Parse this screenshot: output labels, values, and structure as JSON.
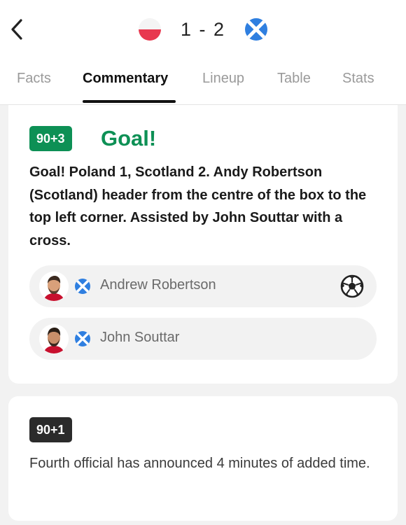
{
  "header": {
    "home_flag": "poland-flag-icon",
    "away_flag": "scotland-flag-icon",
    "score": "1 - 2"
  },
  "tabs": [
    {
      "label": "Facts",
      "active": false
    },
    {
      "label": "Commentary",
      "active": true
    },
    {
      "label": "Lineup",
      "active": false
    },
    {
      "label": "Table",
      "active": false
    },
    {
      "label": "Stats",
      "active": false
    }
  ],
  "events": [
    {
      "minute": "90+3",
      "minute_color": "#0d9055",
      "title": "Goal!",
      "title_color": "#0d9055",
      "text": "Goal! Poland 1, Scotland 2. Andy Robertson (Scotland) header from the centre of the box to the top left corner. Assisted by John Souttar with a cross.",
      "players": [
        {
          "name": "Andrew Robertson",
          "flag": "scotland-flag-icon",
          "action_icon": "football-icon"
        },
        {
          "name": "John Souttar",
          "flag": "scotland-flag-icon"
        }
      ]
    },
    {
      "minute": "90+1",
      "minute_color": "#2b2b2b",
      "text": "Fourth official has announced 4 minutes of added time."
    }
  ],
  "colors": {
    "goal_green": "#0d9055",
    "scotland_blue": "#2f7fe0",
    "poland_red": "#e8384f"
  }
}
